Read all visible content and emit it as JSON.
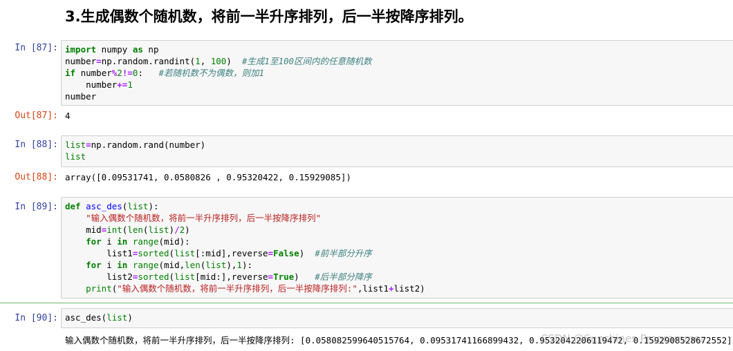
{
  "title": "3.生成偶数个随机数，将前一半升序排列，后一半按降序排列。",
  "cells": [
    {
      "in_prompt": "In  [87]:",
      "out_prompt": "Out[87]:",
      "output": "4"
    },
    {
      "in_prompt": "In  [88]:",
      "out_prompt": "Out[88]:",
      "output": "array([0.09531741, 0.0580826 , 0.95320422, 0.15929085])"
    },
    {
      "in_prompt": "In  [89]:"
    },
    {
      "in_prompt": "In  [90]:",
      "output": "输入偶数个随机数，将前一半升序排列，后一半按降序排列: [0.058082599640515764, 0.09531741166899432, 0.9532042206119472, 0.1592908528672552]"
    }
  ],
  "code": {
    "c87_comment1": "#生成1至100区间内的任意随机数",
    "c87_comment2": "#若随机数不为偶数，则加1",
    "c89_doc": "\"输入偶数个随机数，将前一半升序排列，后一半按降序排列\"",
    "c89_comment1": "#前半部分升序",
    "c89_comment2": "#后半部分降序",
    "c89_printstr": "\"输入偶数个随机数，将前一半升序排列，后一半按降序排列:\""
  },
  "watermark": "CSDN @Sunshines Programmer"
}
